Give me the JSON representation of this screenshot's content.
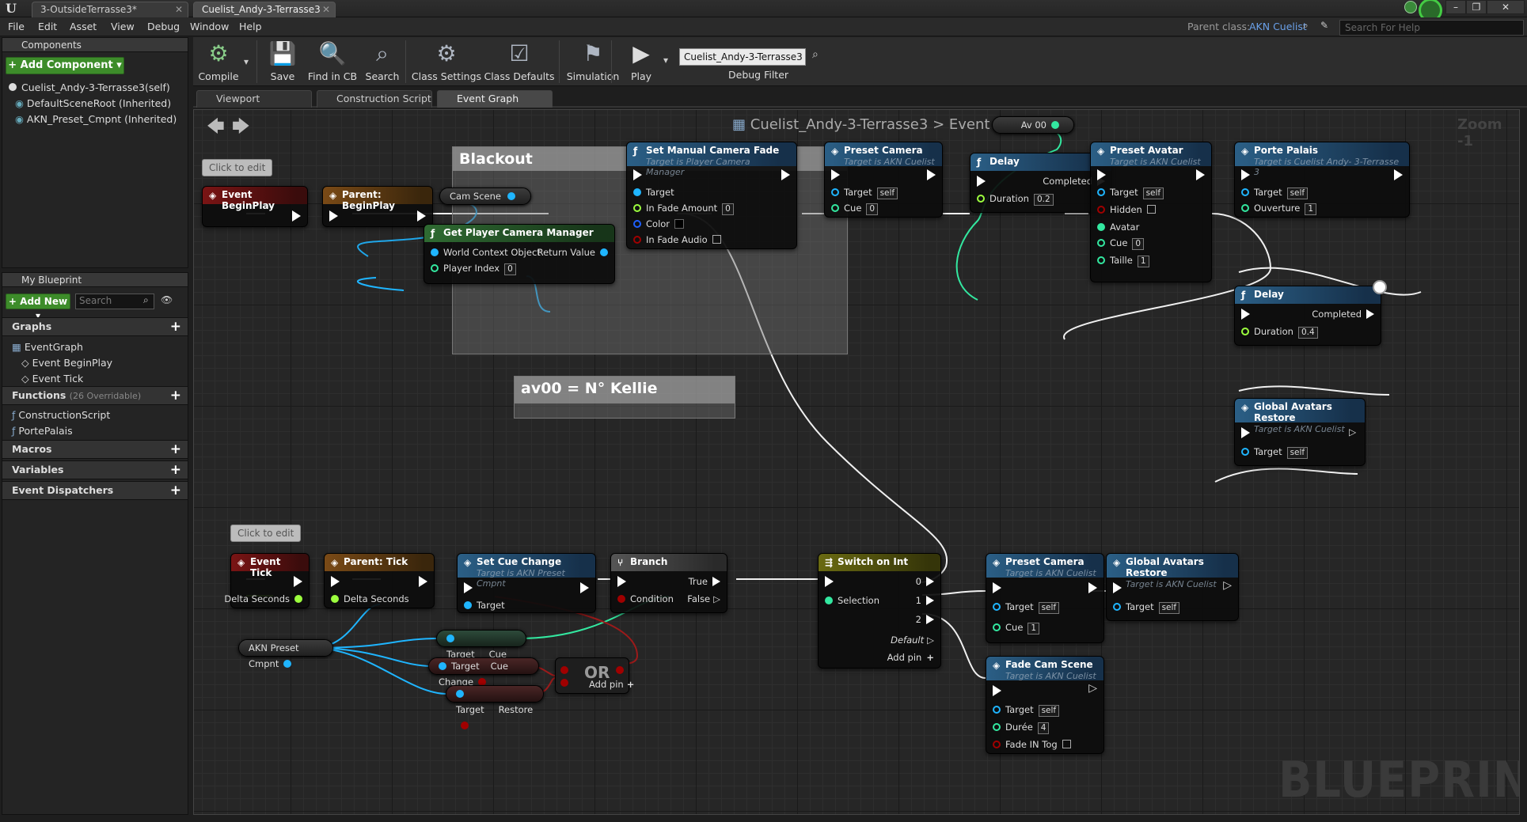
{
  "window": {
    "tabs": [
      "3-OutsideTerrasse3*",
      "Cuelist_Andy-3-Terrasse3"
    ],
    "controls": [
      "–",
      "❐",
      "✕"
    ]
  },
  "menu": [
    "File",
    "Edit",
    "Asset",
    "View",
    "Debug",
    "Window",
    "Help"
  ],
  "parent": {
    "label": "Parent class:",
    "value": "AKN Cuelist"
  },
  "help_search": {
    "placeholder": "Search For Help"
  },
  "components": {
    "tab": "Components",
    "add_label": "+ Add Component ▾",
    "items": [
      "Cuelist_Andy-3-Terrasse3(self)",
      "DefaultSceneRoot (Inherited)",
      "AKN_Preset_Cmpnt (Inherited)"
    ]
  },
  "my_blueprint": {
    "tab": "My Blueprint",
    "add_new": "+ Add New ▾",
    "search_placeholder": "Search",
    "graphs_label": "Graphs",
    "graphs": [
      "EventGraph",
      "Event BeginPlay",
      "Event Tick"
    ],
    "functions_label": "Functions",
    "functions_note": "(26 Overridable)",
    "functions": [
      "ConstructionScript",
      "PortePalais"
    ],
    "macros_label": "Macros",
    "variables_label": "Variables",
    "dispatchers_label": "Event Dispatchers"
  },
  "toolbar": {
    "compile": "Compile",
    "save": "Save",
    "find_in_cb": "Find in CB",
    "search": "Search",
    "class_settings": "Class Settings",
    "class_defaults": "Class Defaults",
    "simulation": "Simulation",
    "play": "Play",
    "debug_select": "Cuelist_Andy-3-Terrasse3 ▾",
    "debug_filter": "Debug Filter"
  },
  "editor_tabs": [
    "Viewport",
    "Construction Script",
    "Event Graph"
  ],
  "graph": {
    "breadcrumb_root": "Cuelist_Andy-3-Terrasse3",
    "breadcrumb_sep": ">",
    "breadcrumb_leaf": "Event Graph",
    "zoom": "Zoom -1",
    "watermark": "BLUEPRINT",
    "comment_blackout": "Blackout",
    "comment_av00": "av00 =  N° Kellie",
    "note_edit": "Click to edit",
    "nodes": {
      "event_beginplay": "Event BeginPlay",
      "parent_beginplay": "Parent: BeginPlay",
      "set_fade": {
        "title": "Set Manual Camera Fade",
        "sub": "Target is Player Camera Manager",
        "pins": [
          "Target",
          "In Fade Amount",
          "Color",
          "In Fade Audio"
        ],
        "fade_amount": "0"
      },
      "get_pcm": {
        "title": "Get Player Camera Manager",
        "pins": [
          "World Context Object",
          "Return Value",
          "Player Index"
        ],
        "player_index": "0"
      },
      "cam_scene": "Cam Scene",
      "preset_camera_1": {
        "title": "Preset Camera",
        "sub": "Target is AKN Cuelist",
        "target": "Target",
        "self": "self",
        "cue": "Cue",
        "cue_val": "0"
      },
      "delay_1": {
        "title": "Delay",
        "completed": "Completed",
        "duration": "Duration",
        "duration_val": "0.2"
      },
      "av00": "Av 00",
      "preset_avatar": {
        "title": "Preset Avatar",
        "sub": "Target is AKN Cuelist",
        "pins": [
          "Target",
          "Hidden",
          "Avatar",
          "Cue",
          "Taille"
        ],
        "cue_val": "0",
        "taille_val": "1"
      },
      "porte_palais": {
        "title": "Porte Palais",
        "sub": "Target is Cuelist Andy- 3-Terrasse 3",
        "pins": [
          "Target",
          "Ouverture"
        ],
        "ouverture_val": "1"
      },
      "delay_2": {
        "title": "Delay",
        "completed": "Completed",
        "duration": "Duration",
        "duration_val": "0.4"
      },
      "gar_1": {
        "title": "Global Avatars Restore",
        "sub": "Target is AKN Cuelist"
      },
      "event_tick": {
        "title": "Event Tick",
        "delta": "Delta Seconds"
      },
      "parent_tick": {
        "title": "Parent: Tick",
        "delta": "Delta Seconds"
      },
      "set_cue_change": {
        "title": "Set Cue Change",
        "sub": "Target is AKN Preset Cmpnt",
        "target": "Target"
      },
      "branch": {
        "title": "Branch",
        "true": "True",
        "false": "False",
        "condition": "Condition"
      },
      "switch": {
        "title": "Switch on Int",
        "selection": "Selection",
        "outs": [
          "0",
          "1",
          "2"
        ],
        "default": "Default",
        "add_pin": "Add pin"
      },
      "preset_camera_2": {
        "title": "Preset Camera",
        "sub": "Target is AKN Cuelist",
        "cue_val": "1"
      },
      "gar_2": {
        "title": "Global Avatars Restore",
        "sub": "Target is AKN Cuelist"
      },
      "fade_cam": {
        "title": "Fade Cam Scene",
        "sub": "Target is AKN Cuelist",
        "pins": [
          "Target",
          "Durée",
          "Fade IN Tog"
        ],
        "duree_val": "4"
      },
      "akn_preset": "AKN Preset Cmpnt",
      "get_cue": {
        "target": "Target",
        "out": "Cue"
      },
      "get_cue_change": {
        "target": "Target",
        "out": "Cue Change"
      },
      "get_restore": {
        "target": "Target",
        "out": "Restore"
      },
      "or": {
        "title": "OR",
        "add_pin": "Add pin"
      }
    }
  },
  "colors": {
    "exec": "#ffffff",
    "object": "#1fb5ff",
    "int": "#33e8a0",
    "bool": "#a00000",
    "float": "#9cfe3e"
  }
}
